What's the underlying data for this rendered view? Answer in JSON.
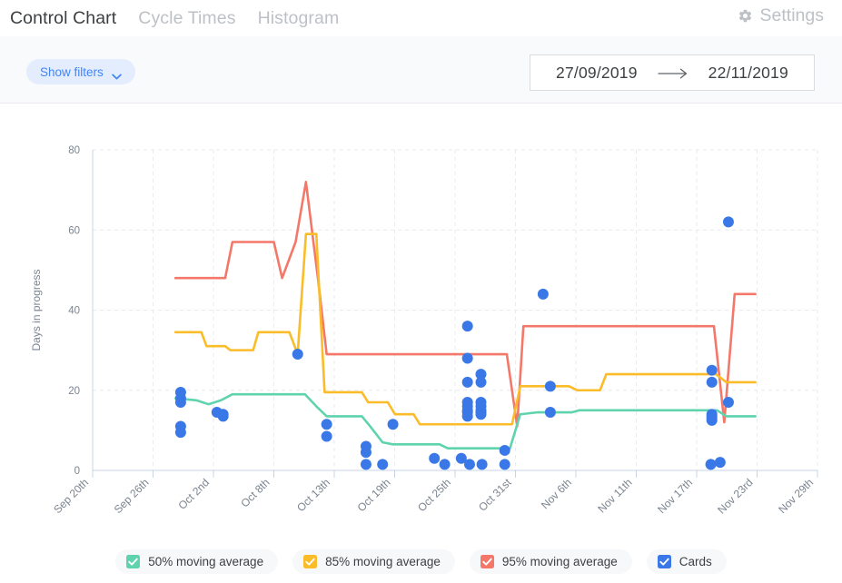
{
  "header": {
    "tabs": [
      {
        "label": "Control Chart",
        "active": true
      },
      {
        "label": "Cycle Times",
        "active": false
      },
      {
        "label": "Histogram",
        "active": false
      }
    ],
    "settings_label": "Settings",
    "settings_icon": "gear-icon"
  },
  "toolbar": {
    "show_filters_label": "Show filters",
    "show_filters_icon": "chevron-down-icon",
    "date_from": "27/09/2019",
    "date_to": "22/11/2019",
    "range_arrow_icon": "arrow-right-icon"
  },
  "legend": [
    {
      "label": "50% moving average",
      "color": "#5FD3AE",
      "checked": true
    },
    {
      "label": "85% moving average",
      "color": "#FBBC29",
      "checked": true
    },
    {
      "label": "95% moving average",
      "color": "#F4786A",
      "checked": true
    },
    {
      "label": "Cards",
      "color": "#3B78E7",
      "checked": true
    }
  ],
  "colors": {
    "accent": "#4285f4",
    "p50": "#5FD3AE",
    "p85": "#FBBC29",
    "p95": "#F4786A",
    "cards": "#3B78E7",
    "axis": "#c9d4e8",
    "grid": "#e8eaed",
    "tab_active": "#3c4043",
    "tab_inactive": "#bdc1c6",
    "toolbar_bg": "#f9fafb",
    "pill_bg": "#e4edfd"
  },
  "chart_data": {
    "type": "line",
    "title": "Control Chart",
    "xlabel": "",
    "ylabel": "Days in progress",
    "ylim": [
      0,
      80
    ],
    "yticks": [
      0,
      20,
      40,
      60,
      80
    ],
    "grid": true,
    "legend_position": "bottom",
    "xticks": [
      "Sep 20th",
      "Sep 26th",
      "Oct 2nd",
      "Oct 8th",
      "Oct 13th",
      "Oct 19th",
      "Oct 25th",
      "Oct 31st",
      "Nov 6th",
      "Nov 11th",
      "Nov 17th",
      "Nov 23rd",
      "Nov 29th"
    ],
    "x_start_date": "Sep 20th",
    "x_end_date": "Nov 29th",
    "x_day_span": 70,
    "series": [
      {
        "name": "95% moving average",
        "color": "#F4786A",
        "type": "step-line",
        "points": [
          [
            8.0,
            48
          ],
          [
            12.8,
            48
          ],
          [
            13.5,
            57
          ],
          [
            17.5,
            57
          ],
          [
            18.3,
            48
          ],
          [
            19.6,
            57
          ],
          [
            20.6,
            72
          ],
          [
            21.8,
            47
          ],
          [
            22.6,
            29
          ],
          [
            40.0,
            29
          ],
          [
            41.0,
            11
          ],
          [
            41.6,
            36
          ],
          [
            60.0,
            36
          ],
          [
            61.0,
            12
          ],
          [
            62.0,
            44
          ],
          [
            64.0,
            44
          ]
        ]
      },
      {
        "name": "85% moving average",
        "color": "#FBBC29",
        "type": "step-line",
        "points": [
          [
            8.0,
            34.5
          ],
          [
            10.5,
            34.5
          ],
          [
            11.0,
            31
          ],
          [
            12.8,
            31
          ],
          [
            13.3,
            30
          ],
          [
            15.5,
            30
          ],
          [
            16.0,
            34.5
          ],
          [
            19.0,
            34.5
          ],
          [
            19.8,
            29
          ],
          [
            20.6,
            59
          ],
          [
            21.6,
            59
          ],
          [
            22.4,
            19.5
          ],
          [
            26.0,
            19.5
          ],
          [
            26.6,
            17
          ],
          [
            28.5,
            17
          ],
          [
            29.2,
            14
          ],
          [
            31.0,
            14
          ],
          [
            31.6,
            11.5
          ],
          [
            40.5,
            11.5
          ],
          [
            41.3,
            21
          ],
          [
            46.0,
            21
          ],
          [
            46.8,
            20
          ],
          [
            49.0,
            20
          ],
          [
            49.6,
            24
          ],
          [
            60.2,
            24
          ],
          [
            61.2,
            22
          ],
          [
            64.0,
            22
          ]
        ]
      },
      {
        "name": "50% moving average",
        "color": "#5FD3AE",
        "type": "step-line",
        "points": [
          [
            8.0,
            18
          ],
          [
            10.0,
            17.5
          ],
          [
            11.2,
            16.5
          ],
          [
            12.4,
            17.5
          ],
          [
            13.5,
            19
          ],
          [
            20.5,
            19
          ],
          [
            21.6,
            16
          ],
          [
            22.6,
            13.5
          ],
          [
            26.0,
            13.5
          ],
          [
            26.8,
            11
          ],
          [
            28.0,
            7
          ],
          [
            29.0,
            6.5
          ],
          [
            33.5,
            6.5
          ],
          [
            34.3,
            5.5
          ],
          [
            40.3,
            5.5
          ],
          [
            41.3,
            14
          ],
          [
            43.0,
            14.5
          ],
          [
            46.3,
            14.5
          ],
          [
            47.0,
            15
          ],
          [
            60.3,
            15
          ],
          [
            61.2,
            13.5
          ],
          [
            64.0,
            13.5
          ]
        ]
      },
      {
        "name": "Cards",
        "color": "#3B78E7",
        "type": "scatter",
        "points": [
          [
            8.5,
            19.5
          ],
          [
            8.5,
            18
          ],
          [
            8.5,
            17
          ],
          [
            8.5,
            11
          ],
          [
            8.5,
            9.5
          ],
          [
            12.0,
            14.5
          ],
          [
            12.6,
            13.5
          ],
          [
            12.6,
            14
          ],
          [
            19.8,
            29
          ],
          [
            22.6,
            11.5
          ],
          [
            22.6,
            8.5
          ],
          [
            26.4,
            6
          ],
          [
            26.4,
            4.5
          ],
          [
            26.4,
            1.5
          ],
          [
            28.0,
            1.5
          ],
          [
            29.0,
            11.5
          ],
          [
            33.0,
            3
          ],
          [
            34.0,
            1.5
          ],
          [
            36.2,
            36
          ],
          [
            36.2,
            28
          ],
          [
            36.2,
            22
          ],
          [
            36.2,
            17
          ],
          [
            36.2,
            16
          ],
          [
            36.2,
            15
          ],
          [
            36.2,
            14.5
          ],
          [
            36.2,
            13.5
          ],
          [
            37.5,
            24
          ],
          [
            37.5,
            22
          ],
          [
            37.5,
            17
          ],
          [
            37.5,
            16
          ],
          [
            37.5,
            15
          ],
          [
            37.5,
            14.5
          ],
          [
            37.5,
            14
          ],
          [
            35.6,
            3
          ],
          [
            36.4,
            1.5
          ],
          [
            37.6,
            1.5
          ],
          [
            39.8,
            5
          ],
          [
            39.8,
            1.5
          ],
          [
            43.5,
            44
          ],
          [
            44.2,
            21
          ],
          [
            44.2,
            14.5
          ],
          [
            59.8,
            25
          ],
          [
            59.8,
            22
          ],
          [
            59.8,
            14
          ],
          [
            59.8,
            13.5
          ],
          [
            59.8,
            13
          ],
          [
            59.8,
            12.5
          ],
          [
            59.7,
            1.5
          ],
          [
            60.6,
            2
          ],
          [
            61.4,
            62
          ],
          [
            61.4,
            17
          ]
        ]
      }
    ]
  }
}
